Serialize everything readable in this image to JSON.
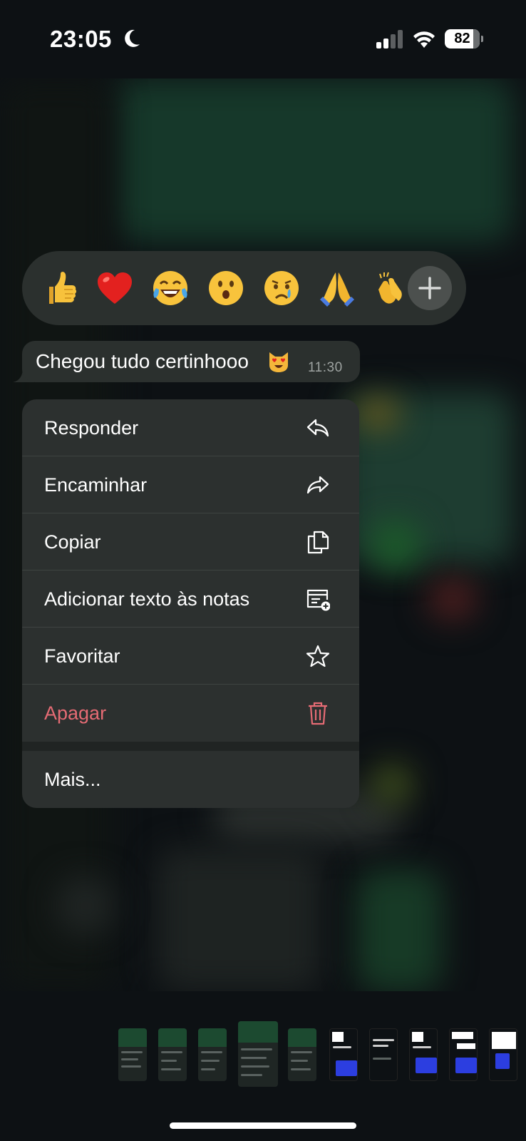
{
  "status_bar": {
    "time": "23:05",
    "battery_percent": 82,
    "battery_label": "82",
    "icons": [
      "moon-icon",
      "signal-icon",
      "wifi-icon",
      "battery-icon"
    ]
  },
  "reactions": [
    {
      "name": "thumbs-up",
      "emoji": "👍"
    },
    {
      "name": "red-heart",
      "emoji": "❤️"
    },
    {
      "name": "tears-of-joy",
      "emoji": "😂"
    },
    {
      "name": "surprised",
      "emoji": "😮"
    },
    {
      "name": "crying",
      "emoji": "😢"
    },
    {
      "name": "folded-hands",
      "emoji": "🙏"
    },
    {
      "name": "clapping-hands",
      "emoji": "👏"
    }
  ],
  "message": {
    "text": "Chegou tudo certinhooo",
    "emoji": "😻",
    "time": "11:30"
  },
  "menu": {
    "items": [
      {
        "label": "Responder",
        "icon": "reply-icon"
      },
      {
        "label": "Encaminhar",
        "icon": "forward-icon"
      },
      {
        "label": "Copiar",
        "icon": "copy-icon"
      },
      {
        "label": "Adicionar texto às notas",
        "icon": "add-note-icon"
      },
      {
        "label": "Favoritar",
        "icon": "star-icon"
      },
      {
        "label": "Apagar",
        "icon": "trash-icon"
      }
    ],
    "more_label": "Mais..."
  },
  "colors": {
    "background": "#0d1114",
    "menu_background": "#2c302f",
    "bubble_background": "#2b302e",
    "danger": "#e56b74",
    "timestamp": "#9ea3a1"
  }
}
